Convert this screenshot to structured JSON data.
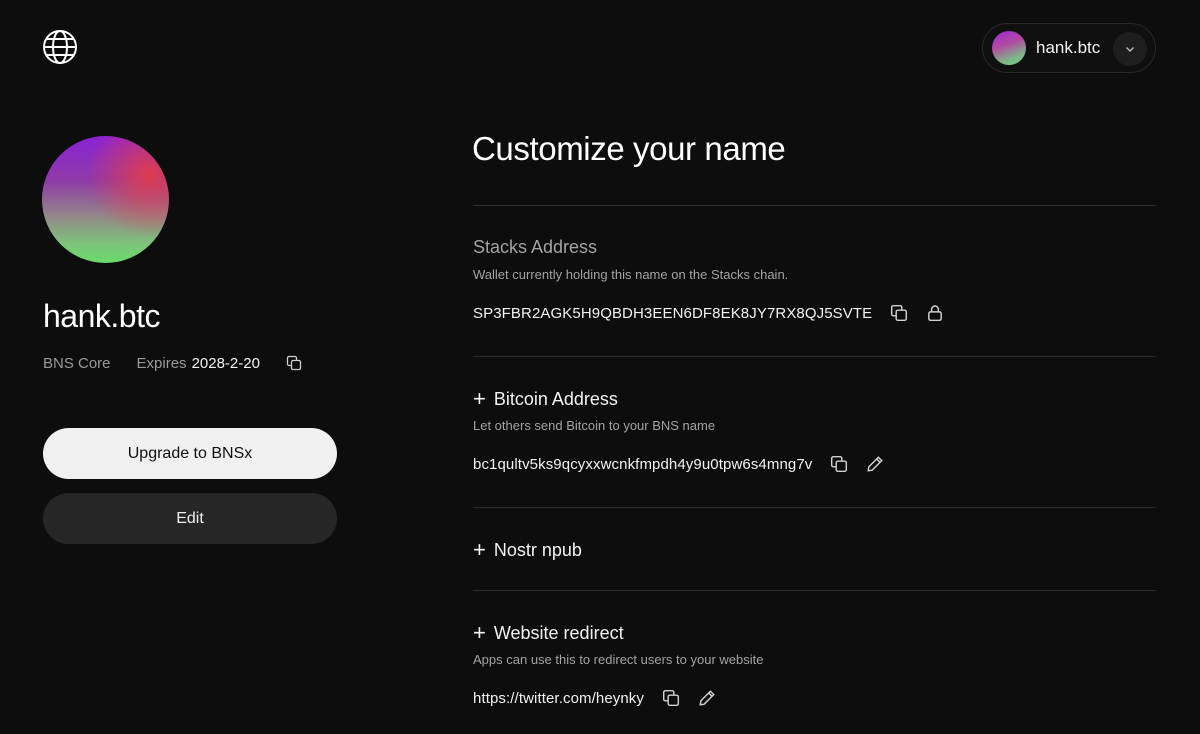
{
  "header": {
    "logo_icon": "globe-icon",
    "account": {
      "name": "hank.btc",
      "chevron_icon": "chevron-down-icon"
    }
  },
  "profile": {
    "name": "hank.btc",
    "namespace": "BNS Core",
    "expires_label": "Expires",
    "expires_value": "2028-2-20",
    "copy_icon": "copy-icon",
    "upgrade_button": "Upgrade to BNSx",
    "edit_button": "Edit"
  },
  "main": {
    "title": "Customize your name",
    "sections": [
      {
        "title": "Stacks Address",
        "description": "Wallet currently holding this name on the Stacks chain.",
        "value": "SP3FBR2AGK5H9QBDH3EEN6DF8EK8JY7RX8QJ5SVTE",
        "icons": [
          "copy-icon",
          "lock-icon"
        ]
      },
      {
        "title": "Bitcoin Address",
        "description": "Let others send Bitcoin to your BNS name",
        "value": "bc1qultv5ks9qcyxxwcnkfmpdh4y9u0tpw6s4mng7v",
        "icons": [
          "copy-icon",
          "pencil-icon"
        ]
      },
      {
        "title": "Nostr npub"
      },
      {
        "title": "Website redirect",
        "description": "Apps can use this to redirect users to your website",
        "value": "https://twitter.com/heynky",
        "icons": [
          "copy-icon",
          "pencil-icon"
        ]
      }
    ]
  },
  "colors": {
    "background": "#0d0d0d",
    "primary_button_bg": "#f0f0f0",
    "secondary_button_bg": "#262626",
    "muted_text": "#a3a3a3"
  }
}
